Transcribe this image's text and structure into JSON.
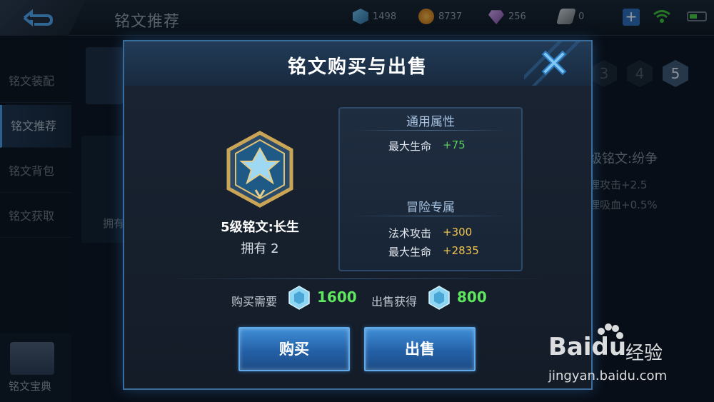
{
  "topbar": {
    "title": "铭文推荐",
    "currencies": [
      {
        "icon": "crystal-icon",
        "value": "1498",
        "color": "#5fa8d8"
      },
      {
        "icon": "gold-coin-icon",
        "value": "8737",
        "color": "#e09a2b"
      },
      {
        "icon": "diamond-icon",
        "value": "256",
        "color": "#b58ad8"
      },
      {
        "icon": "scroll-icon",
        "value": "0",
        "color": "#a9b3bc"
      }
    ],
    "plus_label": "+"
  },
  "sidebar": {
    "items": [
      {
        "label": "铭文装配"
      },
      {
        "label": "铭文推荐"
      },
      {
        "label": "铭文背包"
      },
      {
        "label": "铭文获取"
      }
    ],
    "active_index": 1,
    "bottom_label": "铭文宝典"
  },
  "background": {
    "levels": [
      "3",
      "4",
      "5"
    ],
    "active_level": "5",
    "card_label": "拥有",
    "right_title": "级铭文:纷争",
    "right_lines": [
      "理攻击+2.5",
      "理吸血+0.5%"
    ]
  },
  "modal": {
    "title": "铭文购买与出售",
    "item_name": "5级铭文:长生",
    "owned": "拥有 2",
    "general_title": "通用属性",
    "general_attrs": [
      {
        "label": "最大生命",
        "value": "+75"
      }
    ],
    "adventure_title": "冒险专属",
    "adventure_attrs": [
      {
        "label": "法术攻击",
        "value": "+300"
      },
      {
        "label": "最大生命",
        "value": "+2835"
      }
    ],
    "buy_price_label": "购买需要",
    "buy_price": "1600",
    "sell_price_label": "出售获得",
    "sell_price": "800",
    "buy_button": "购买",
    "sell_button": "出售"
  },
  "watermark": {
    "logo": "Bai",
    "logo_du": "du",
    "jingyan": "经验",
    "url": "jingyan.baidu.com"
  }
}
